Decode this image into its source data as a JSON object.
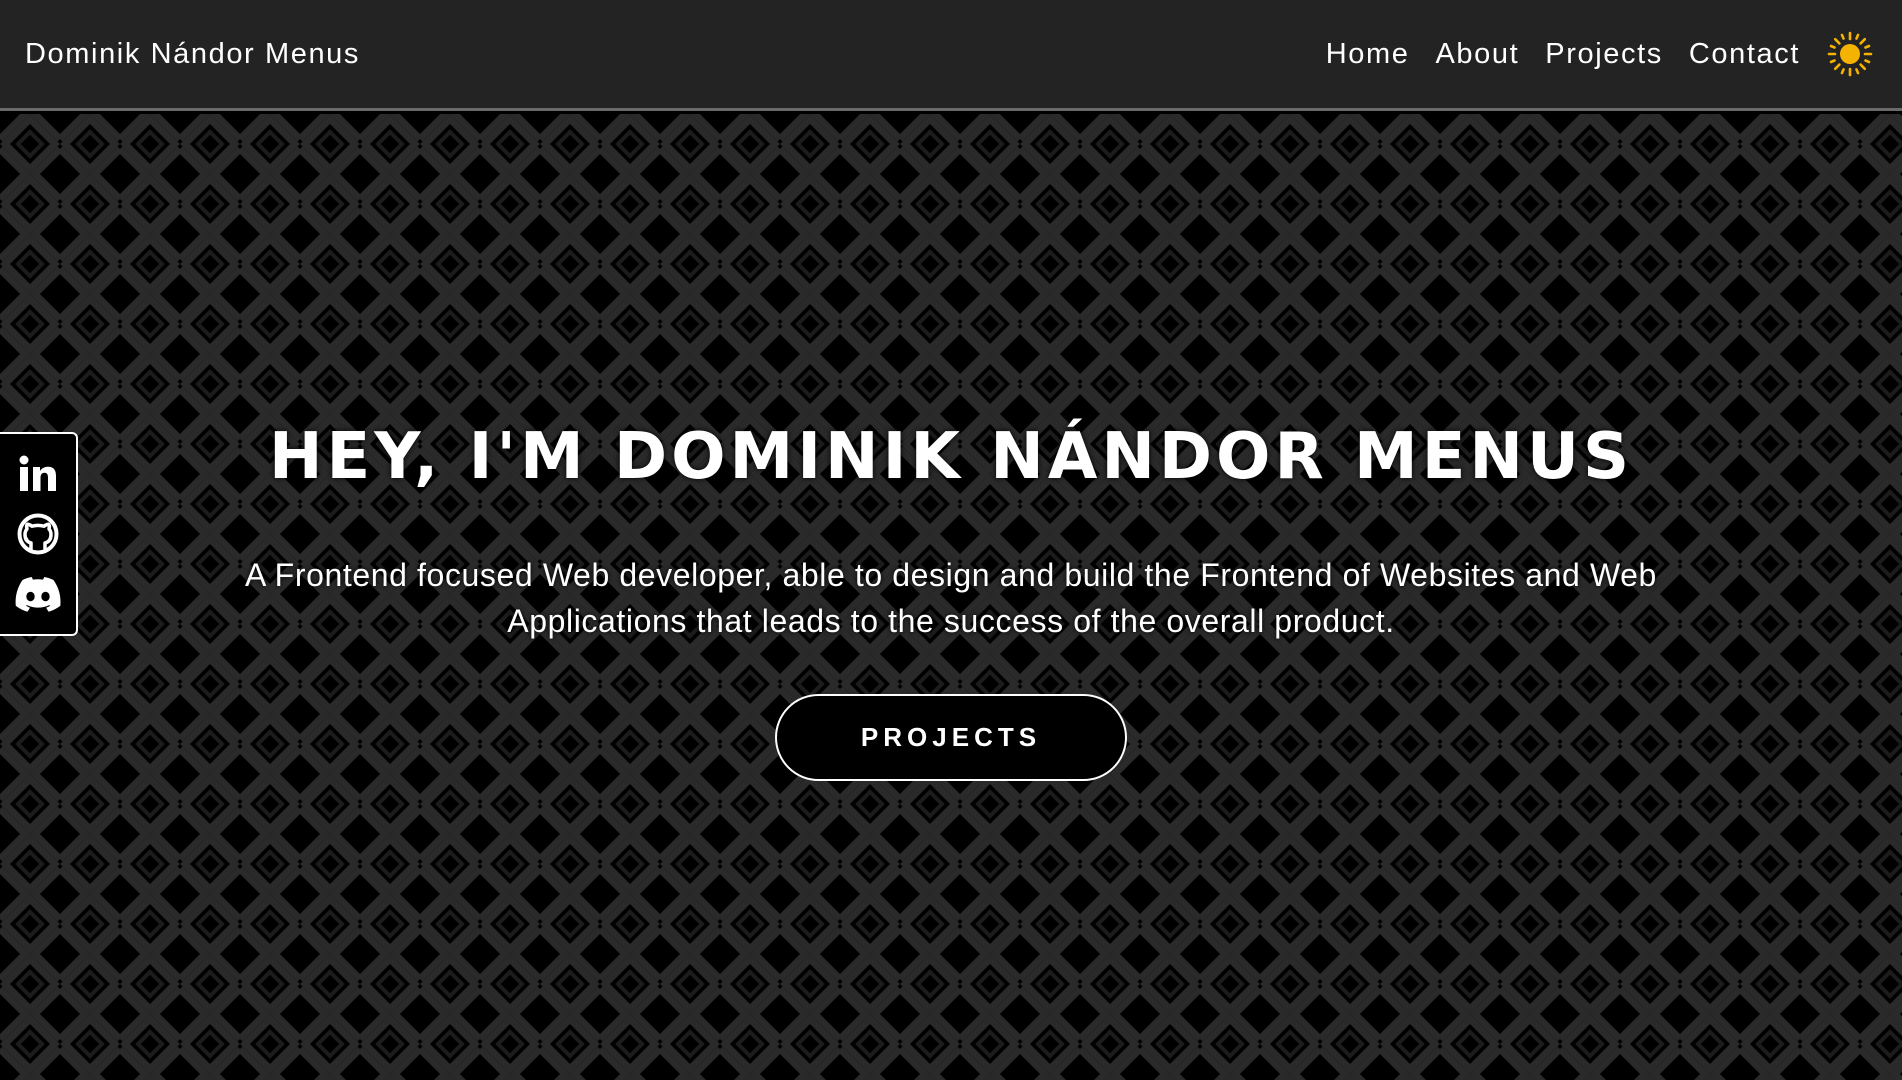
{
  "nav": {
    "brand": "Dominik Nándor Menus",
    "links": [
      {
        "label": "Home"
      },
      {
        "label": "About"
      },
      {
        "label": "Projects"
      },
      {
        "label": "Contact"
      }
    ],
    "theme_icon": "sun-icon",
    "theme_icon_color": "#f5b301"
  },
  "social": {
    "icons": [
      "linkedin-icon",
      "github-icon",
      "discord-icon"
    ]
  },
  "hero": {
    "title": "HEY, I'M DOMINIK NÁNDOR MENUS",
    "subtitle": "A Frontend focused Web developer, able to design and build the Frontend of Websites and Web Applications that leads to the success of the overall product.",
    "button_label": "PROJECTS"
  },
  "colors": {
    "navbar_bg": "#232323",
    "navbar_border": "#6a6a6a",
    "page_bg": "#000000",
    "pattern_stroke": "#2a2a2a",
    "text": "#ffffff"
  }
}
